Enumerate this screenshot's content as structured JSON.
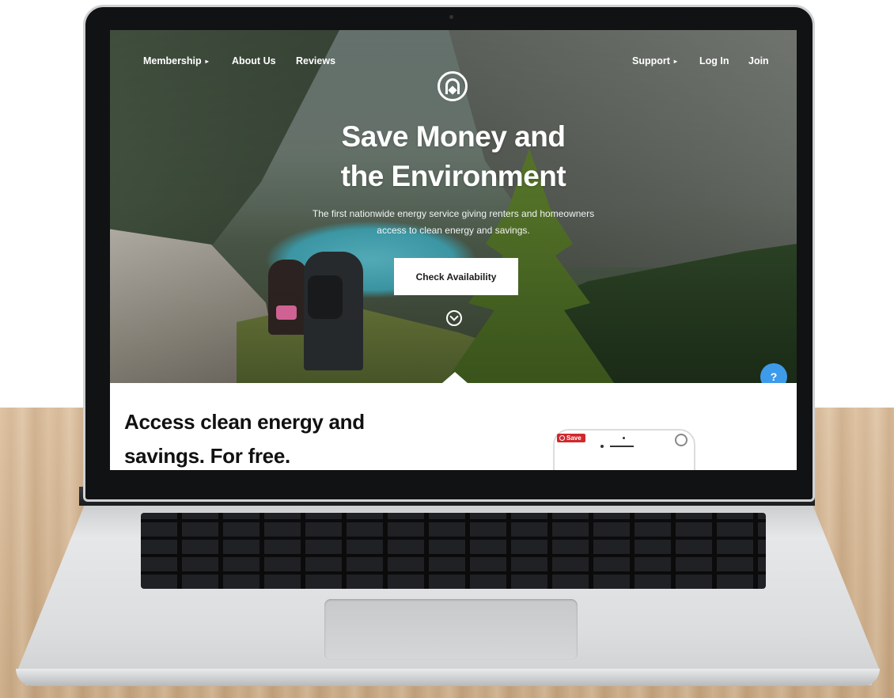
{
  "nav": {
    "membership": "Membership",
    "about": "About Us",
    "reviews": "Reviews",
    "support": "Support",
    "login": "Log In",
    "join": "Join",
    "caret": "▸"
  },
  "hero": {
    "headline_line1": "Save Money and",
    "headline_line2": "the Environment",
    "subtitle_line1": "The first nationwide energy service giving renters and homeowners",
    "subtitle_line2": "access to clean energy and savings.",
    "cta": "Check Availability"
  },
  "help": {
    "label": "?"
  },
  "section": {
    "title_line1": "Access clean energy and",
    "title_line2": "savings. For free."
  },
  "save_badge": {
    "label": "Save"
  },
  "colors": {
    "help_button": "#3d9be9",
    "save_badge": "#d0282e",
    "cta_background": "#ffffff"
  },
  "icons": [
    "logo-icon",
    "chevron-right-icon",
    "scroll-down-icon",
    "help-icon",
    "pinterest-icon"
  ]
}
